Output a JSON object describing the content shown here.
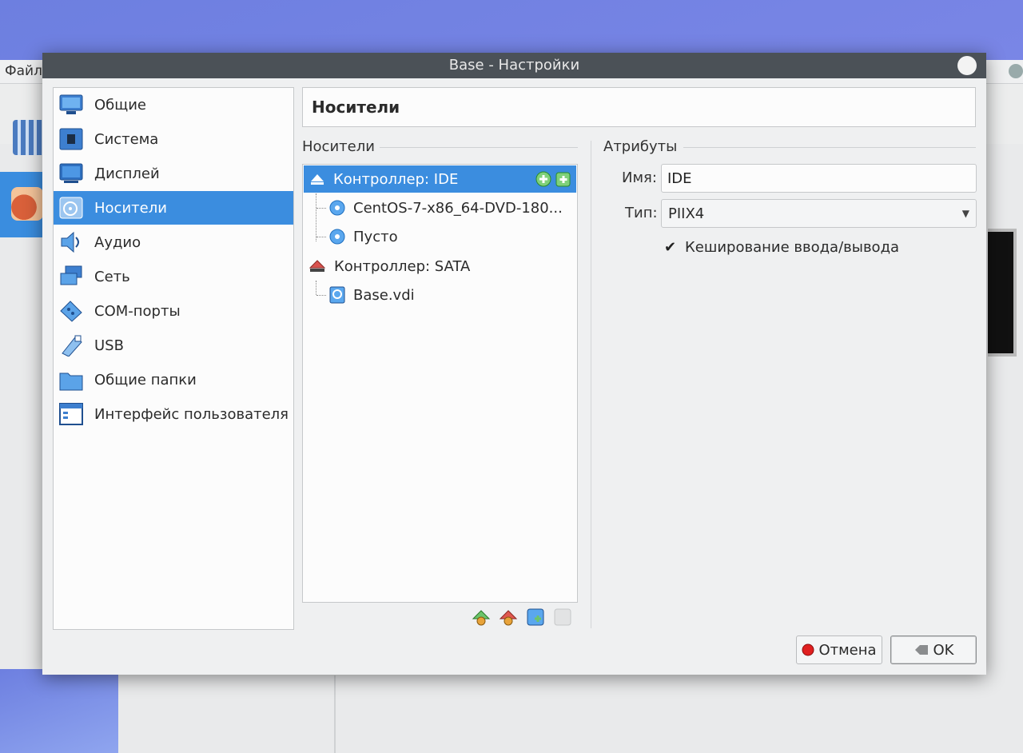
{
  "background_app": {
    "menu_file": "Файл"
  },
  "dialog": {
    "title": "Base - Настройки"
  },
  "nav": {
    "items": [
      {
        "label": "Общие",
        "icon": "monitor-general-icon",
        "selected": false
      },
      {
        "label": "Система",
        "icon": "chip-system-icon",
        "selected": false
      },
      {
        "label": "Дисплей",
        "icon": "display-icon",
        "selected": false
      },
      {
        "label": "Носители",
        "icon": "storage-disk-icon",
        "selected": true
      },
      {
        "label": "Аудио",
        "icon": "speaker-icon",
        "selected": false
      },
      {
        "label": "Сеть",
        "icon": "network-icon",
        "selected": false
      },
      {
        "label": "COM-порты",
        "icon": "serial-port-icon",
        "selected": false
      },
      {
        "label": "USB",
        "icon": "usb-icon",
        "selected": false
      },
      {
        "label": "Общие папки",
        "icon": "shared-folder-icon",
        "selected": false
      },
      {
        "label": "Интерфейс пользователя",
        "icon": "user-interface-icon",
        "selected": false
      }
    ]
  },
  "page": {
    "header": "Носители",
    "storage_group_label": "Носители",
    "attributes_group_label": "Атрибуты"
  },
  "tree": {
    "rows": [
      {
        "label": "Контроллер: IDE",
        "type": "controller",
        "selected": true
      },
      {
        "label": "CentOS-7-x86_64-DVD-180...",
        "type": "optical",
        "selected": false
      },
      {
        "label": "Пусто",
        "type": "optical",
        "selected": false
      },
      {
        "label": "Контроллер: SATA",
        "type": "controller",
        "selected": false
      },
      {
        "label": "Base.vdi",
        "type": "hdd",
        "selected": false
      }
    ]
  },
  "attributes": {
    "name_label": "Имя:",
    "name_value": "IDE",
    "type_label": "Тип:",
    "type_value": "PIIX4",
    "io_cache_label": "Кеширование ввода/вывода",
    "io_cache_checked": true
  },
  "buttons": {
    "cancel": "Отмена",
    "ok": "OK"
  },
  "colors": {
    "selection": "#3b8ddf",
    "titlebar": "#4b5157"
  }
}
